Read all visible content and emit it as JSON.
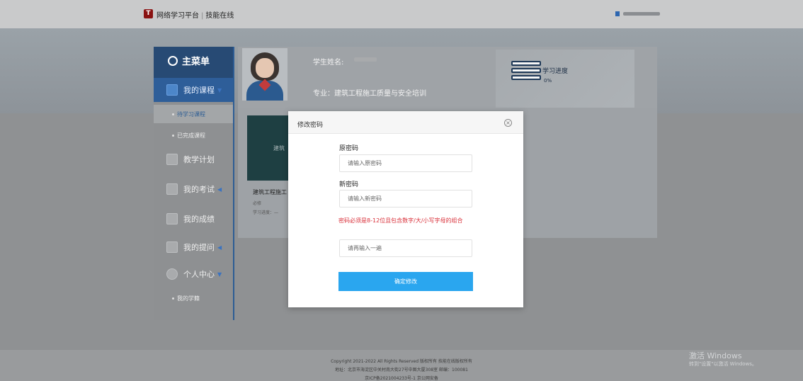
{
  "header": {
    "logo_text": "T",
    "brand": "网络学习平台",
    "brand_sub": "技能在线"
  },
  "sidebar": {
    "title": "主菜单",
    "items": [
      {
        "label": "我的课程",
        "caret": "▼"
      },
      {
        "label": "待学习课程"
      },
      {
        "label": "已完成课程"
      },
      {
        "label": "教学计划"
      },
      {
        "label": "我的考试",
        "caret": "◀"
      },
      {
        "label": "我的成绩"
      },
      {
        "label": "我的提问",
        "caret": "◀"
      },
      {
        "label": "个人中心",
        "caret": "▼"
      },
      {
        "label": "我的学籍"
      }
    ]
  },
  "student": {
    "name_label": "学生姓名:",
    "major": "专业：建筑工程施工质量与安全培训",
    "progress_label": "学习进度",
    "progress_value": "0%"
  },
  "course": {
    "thumb_text": "建筑",
    "title": "建筑工程施工",
    "meta1": "必修",
    "meta2": "学习进度：—"
  },
  "modal": {
    "title": "修改密码",
    "close_symbol": "×",
    "old_password_label": "原密码",
    "old_password_placeholder": "请输入原密码",
    "new_password_label": "新密码",
    "new_password_placeholder": "请输入新密码",
    "password_hint": "密码必须是8-12位且包含数字/大/小写字母的组合",
    "confirm_placeholder": "请再输入一遍",
    "submit_label": "确定修改"
  },
  "footer": {
    "line1": "Copyright 2021-2022 All Rights Reserved 版权所有 技能在线版权所有",
    "line2": "地址：北京市海淀区中关村南大街27号中图大厦308室 邮编：100081",
    "line3": "京ICP备2021004233号-1 京公网安备"
  },
  "os_watermark": {
    "title": "激活 Windows",
    "subtitle": "转到\"设置\"以激活 Windows。"
  }
}
